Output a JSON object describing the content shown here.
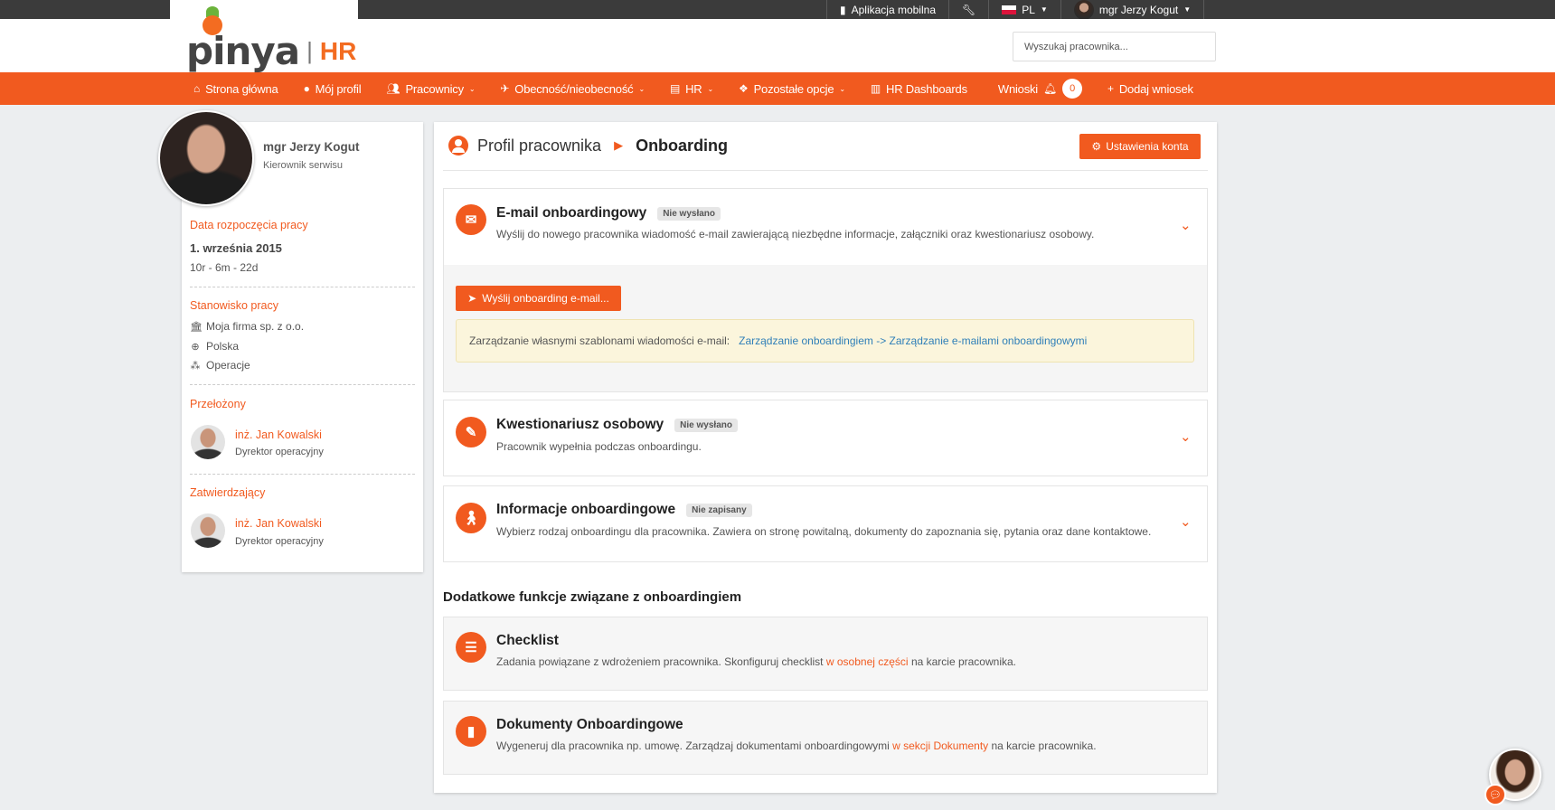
{
  "topbar": {
    "mobile_app": "Aplikacja mobilna",
    "language": "PL",
    "user": "mgr Jerzy Kogut"
  },
  "header": {
    "logo_text": "pinya",
    "logo_suffix": "HR",
    "search_placeholder": "Wyszukaj pracownika..."
  },
  "nav": {
    "home": "Strona główna",
    "profile": "Mój profil",
    "employees": "Pracownicy",
    "attendance": "Obecność/nieobecność",
    "hr": "HR",
    "other": "Pozostałe opcje",
    "dashboards": "HR Dashboards",
    "requests": "Wnioski",
    "requests_count": "0",
    "add_request": "Dodaj wniosek"
  },
  "sidebar": {
    "name": "mgr Jerzy Kogut",
    "role": "Kierownik serwisu",
    "start_label": "Data rozpoczęcia pracy",
    "start_date": "1. września 2015",
    "tenure": "10r - 6m - 22d",
    "position_label": "Stanowisko pracy",
    "company": "Moja firma sp. z o.o.",
    "country": "Polska",
    "department": "Operacje",
    "supervisor_label": "Przełożony",
    "supervisor_name": "inż. Jan Kowalski",
    "supervisor_role": "Dyrektor operacyjny",
    "approver_label": "Zatwierdzający",
    "approver_name": "inż. Jan Kowalski",
    "approver_role": "Dyrektor operacyjny"
  },
  "main": {
    "breadcrumb_parent": "Profil pracownika",
    "breadcrumb_current": "Onboarding",
    "settings_button": "Ustawienia konta",
    "email_card": {
      "title": "E-mail onboardingowy",
      "status": "Nie wysłano",
      "desc": "Wyślij do nowego pracownika wiadomość e-mail zawierającą niezbędne informacje, załączniki oraz kwestionariusz osobowy.",
      "send_button": "Wyślij onboarding e-mail...",
      "alert_text": "Zarządzanie własnymi szablonami wiadomości e-mail:",
      "alert_link": "Zarządzanie onboardingiem -> Zarządzanie e-mailami onboardingowymi"
    },
    "questionnaire_card": {
      "title": "Kwestionariusz osobowy",
      "status": "Nie wysłano",
      "desc": "Pracownik wypełnia podczas onboardingu."
    },
    "info_card": {
      "title": "Informacje onboardingowe",
      "status": "Nie zapisany",
      "desc": "Wybierz rodzaj onboardingu dla pracownika. Zawiera on stronę powitalną, dokumenty do zapoznania się, pytania oraz dane kontaktowe."
    },
    "extra_heading": "Dodatkowe funkcje związane z onboardingiem",
    "checklist_card": {
      "title": "Checklist",
      "desc_before": "Zadania powiązane z wdrożeniem pracownika. Skonfiguruj checklist",
      "desc_link": "w osobnej części",
      "desc_after": "na karcie pracownika."
    },
    "documents_card": {
      "title": "Dokumenty Onboardingowe",
      "desc_before": "Wygeneruj dla pracownika np. umowę. Zarządzaj dokumentami onboardingowymi",
      "desc_link": "w sekcji Dokumenty",
      "desc_after": "na karcie pracownika."
    }
  },
  "colors": {
    "accent": "#f15a1f",
    "topbar": "#3b3b3b",
    "background": "#eceef0"
  }
}
